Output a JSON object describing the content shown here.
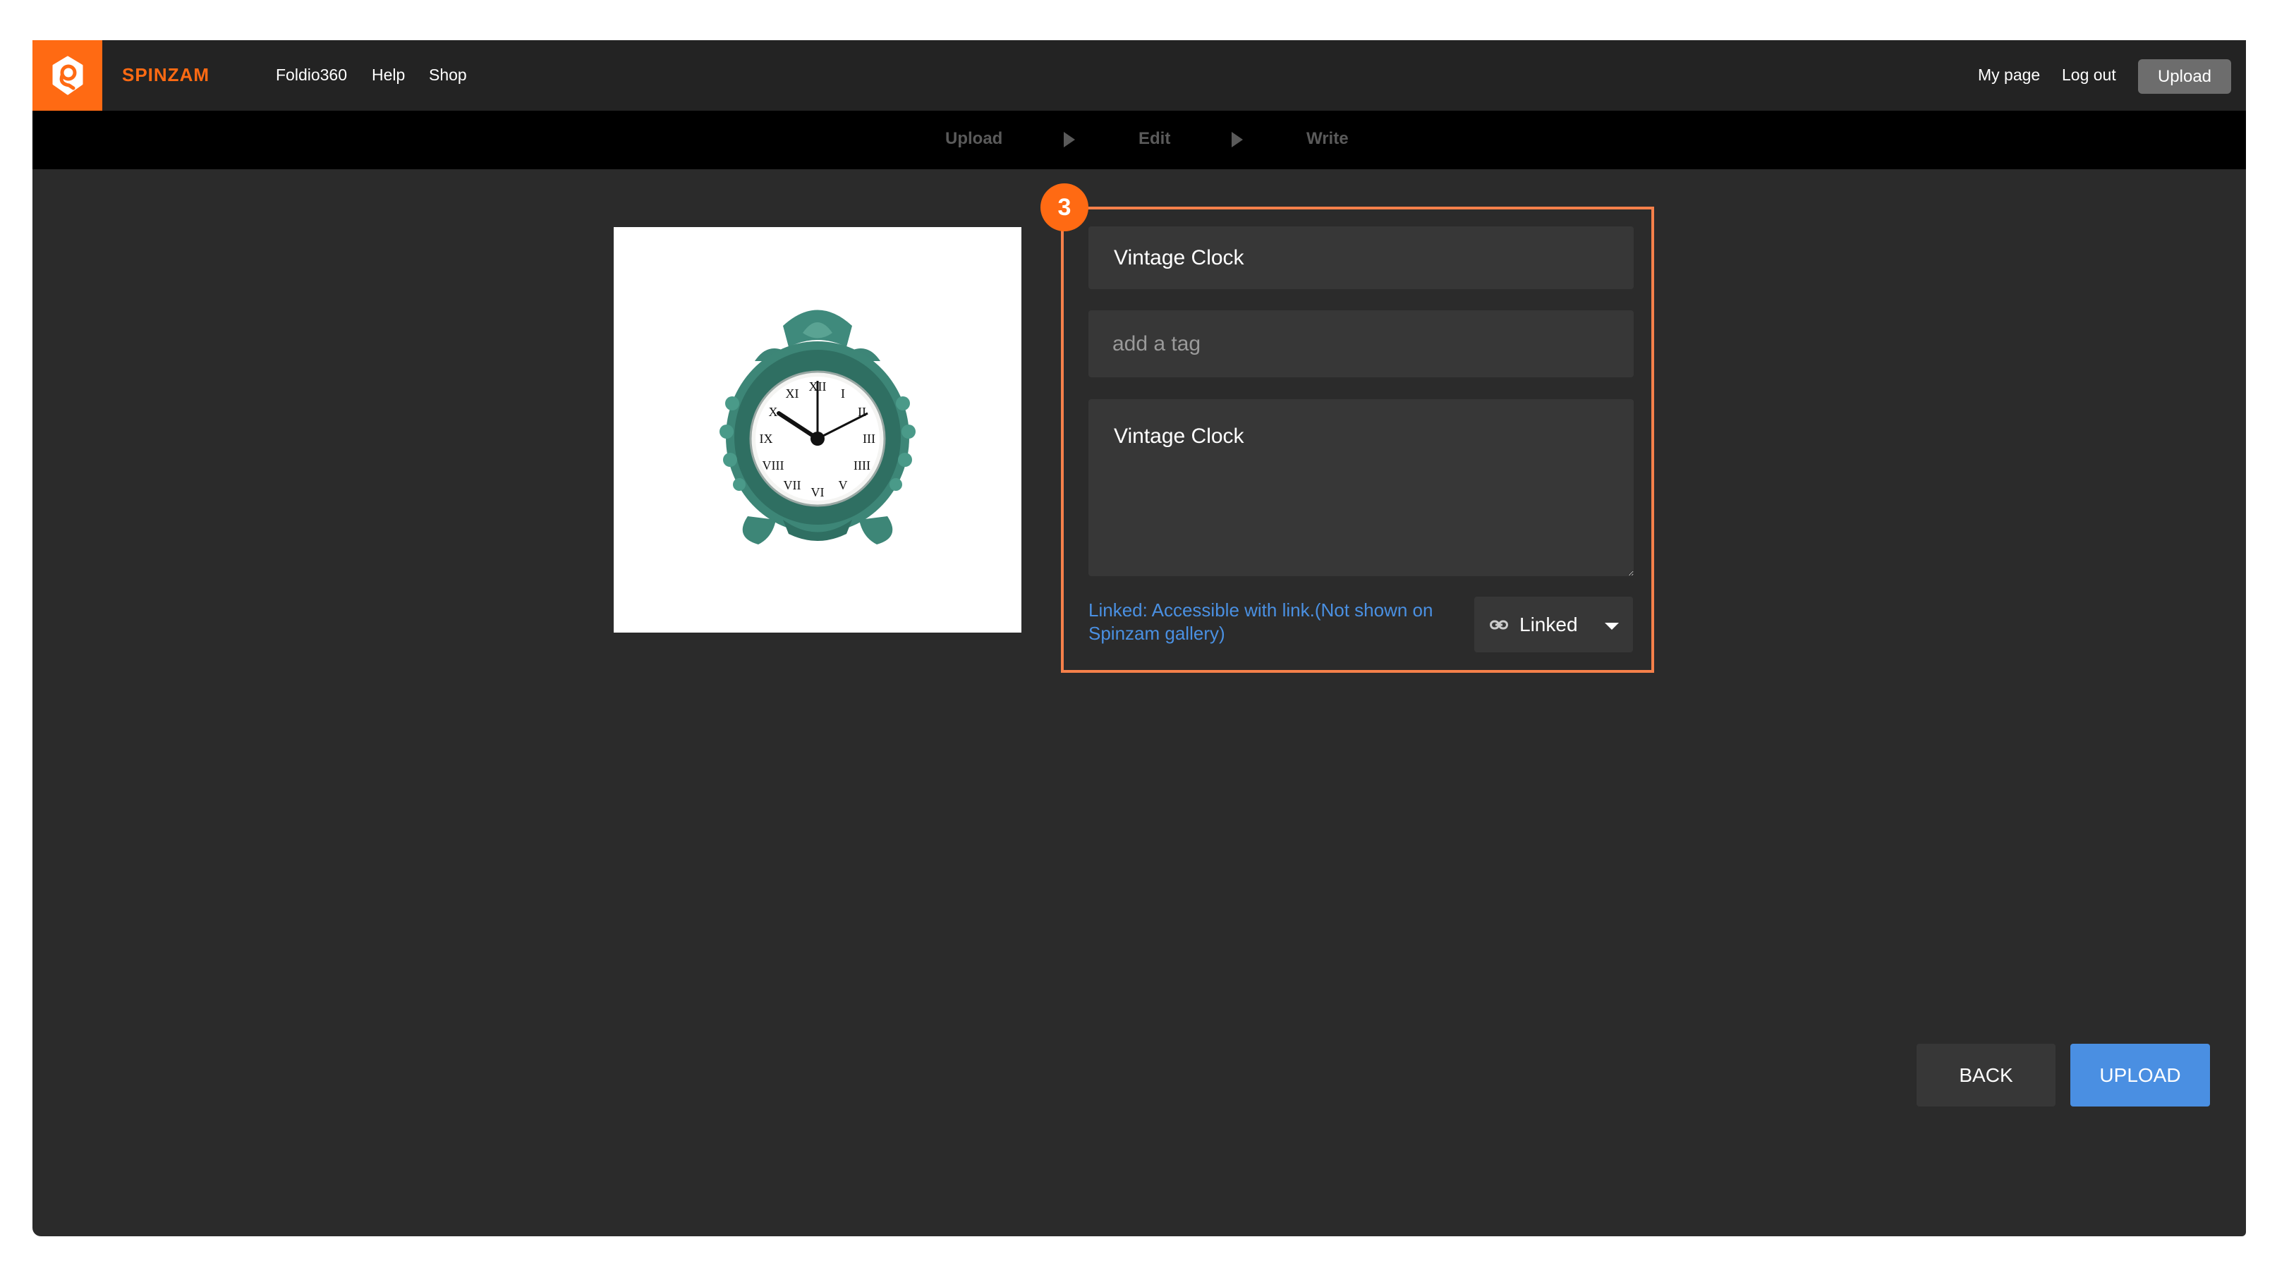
{
  "header": {
    "brand": "SPINZAM",
    "logo_icon": "spinzam-logo-icon",
    "nav": [
      "Foldio360",
      "Help",
      "Shop"
    ],
    "right_links": [
      "My page",
      "Log out"
    ],
    "upload_button": "Upload"
  },
  "steps": {
    "items": [
      "Upload",
      "Edit",
      "Write"
    ],
    "separator_icon": "play-triangle-icon"
  },
  "preview": {
    "alt": "Vintage Clock product photo",
    "subject": "green ornate vintage table clock with roman numerals"
  },
  "form": {
    "step_badge": "3",
    "title_value": "Vintage Clock",
    "tag_placeholder": "add a tag",
    "description_value": "Vintage Clock",
    "visibility_note": "Linked: Accessible with link.(Not shown on Spinzam gallery)",
    "visibility_select": {
      "icon": "link-icon",
      "selected": "Linked"
    }
  },
  "actions": {
    "back": "BACK",
    "upload": "UPLOAD"
  },
  "colors": {
    "accent_orange": "#ff6a13",
    "section_border": "#f5804a",
    "link_blue": "#4a90e2",
    "primary_button": "#4a8fe2"
  }
}
